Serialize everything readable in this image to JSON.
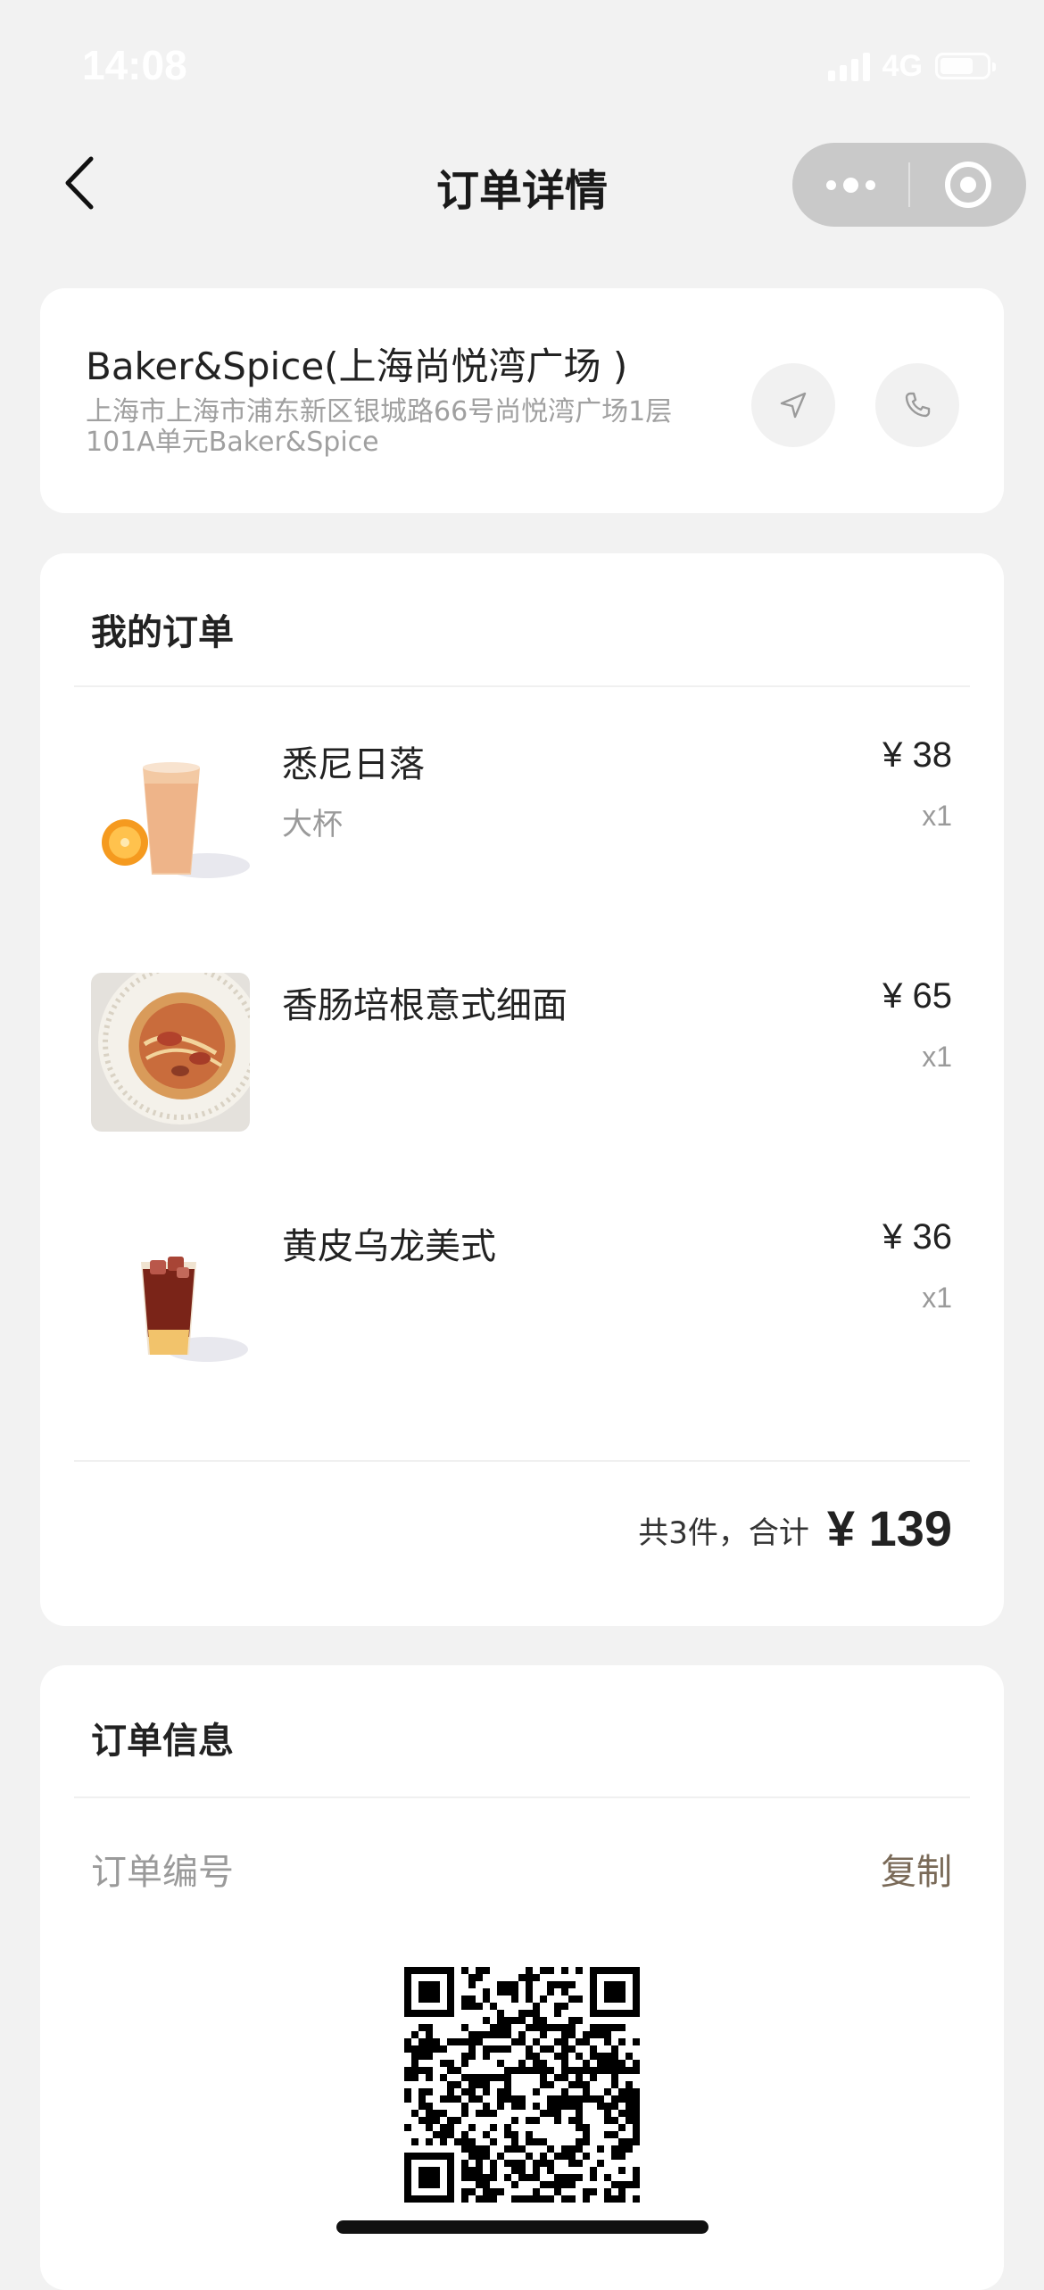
{
  "status_bar": {
    "time": "14:08",
    "network": "4G",
    "icons": [
      "signal-icon",
      "battery-icon"
    ]
  },
  "nav": {
    "title": "订单详情",
    "back_icon": "chevron-left-icon",
    "more_icon": "more-dots-icon",
    "close_icon": "target-circle-icon"
  },
  "store": {
    "name": "Baker&Spice(上海尚悦湾广场 )",
    "address": "上海市上海市浦东新区银城路66号尚悦湾广场1层101A单元Baker&Spice",
    "navigate_icon": "navigate-arrow-icon",
    "call_icon": "phone-icon"
  },
  "order": {
    "title": "我的订单",
    "items": [
      {
        "name": "悉尼日落",
        "spec": "大杯",
        "price": "¥ 38",
        "qty": "x1",
        "image": "orange-smoothie-drink"
      },
      {
        "name": "香肠培根意式细面",
        "spec": "",
        "price": "¥ 65",
        "qty": "x1",
        "image": "spaghetti-plate"
      },
      {
        "name": "黄皮乌龙美式",
        "spec": "",
        "price": "¥ 36",
        "qty": "x1",
        "image": "iced-coffee-drink"
      }
    ],
    "total_label": "共3件，合计",
    "total_amount": "¥ 139"
  },
  "info": {
    "title": "订单信息",
    "order_number_label": "订单编号",
    "copy_label": "复制",
    "qr_icon": "qr-code"
  },
  "colors": {
    "background": "#f2f2f2",
    "card": "#ffffff",
    "accent_copy": "#7a6a58",
    "muted_text": "#9a9a9a"
  }
}
